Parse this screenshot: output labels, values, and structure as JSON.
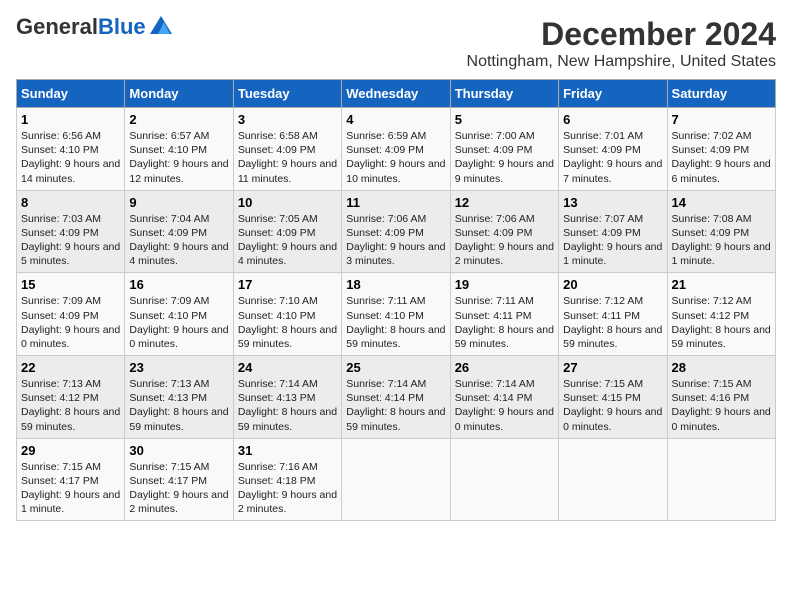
{
  "logo": {
    "general": "General",
    "blue": "Blue"
  },
  "title": "December 2024",
  "subtitle": "Nottingham, New Hampshire, United States",
  "days_of_week": [
    "Sunday",
    "Monday",
    "Tuesday",
    "Wednesday",
    "Thursday",
    "Friday",
    "Saturday"
  ],
  "weeks": [
    [
      {
        "day": "1",
        "sunrise": "Sunrise: 6:56 AM",
        "sunset": "Sunset: 4:10 PM",
        "daylight": "Daylight: 9 hours and 14 minutes."
      },
      {
        "day": "2",
        "sunrise": "Sunrise: 6:57 AM",
        "sunset": "Sunset: 4:10 PM",
        "daylight": "Daylight: 9 hours and 12 minutes."
      },
      {
        "day": "3",
        "sunrise": "Sunrise: 6:58 AM",
        "sunset": "Sunset: 4:09 PM",
        "daylight": "Daylight: 9 hours and 11 minutes."
      },
      {
        "day": "4",
        "sunrise": "Sunrise: 6:59 AM",
        "sunset": "Sunset: 4:09 PM",
        "daylight": "Daylight: 9 hours and 10 minutes."
      },
      {
        "day": "5",
        "sunrise": "Sunrise: 7:00 AM",
        "sunset": "Sunset: 4:09 PM",
        "daylight": "Daylight: 9 hours and 9 minutes."
      },
      {
        "day": "6",
        "sunrise": "Sunrise: 7:01 AM",
        "sunset": "Sunset: 4:09 PM",
        "daylight": "Daylight: 9 hours and 7 minutes."
      },
      {
        "day": "7",
        "sunrise": "Sunrise: 7:02 AM",
        "sunset": "Sunset: 4:09 PM",
        "daylight": "Daylight: 9 hours and 6 minutes."
      }
    ],
    [
      {
        "day": "8",
        "sunrise": "Sunrise: 7:03 AM",
        "sunset": "Sunset: 4:09 PM",
        "daylight": "Daylight: 9 hours and 5 minutes."
      },
      {
        "day": "9",
        "sunrise": "Sunrise: 7:04 AM",
        "sunset": "Sunset: 4:09 PM",
        "daylight": "Daylight: 9 hours and 4 minutes."
      },
      {
        "day": "10",
        "sunrise": "Sunrise: 7:05 AM",
        "sunset": "Sunset: 4:09 PM",
        "daylight": "Daylight: 9 hours and 4 minutes."
      },
      {
        "day": "11",
        "sunrise": "Sunrise: 7:06 AM",
        "sunset": "Sunset: 4:09 PM",
        "daylight": "Daylight: 9 hours and 3 minutes."
      },
      {
        "day": "12",
        "sunrise": "Sunrise: 7:06 AM",
        "sunset": "Sunset: 4:09 PM",
        "daylight": "Daylight: 9 hours and 2 minutes."
      },
      {
        "day": "13",
        "sunrise": "Sunrise: 7:07 AM",
        "sunset": "Sunset: 4:09 PM",
        "daylight": "Daylight: 9 hours and 1 minute."
      },
      {
        "day": "14",
        "sunrise": "Sunrise: 7:08 AM",
        "sunset": "Sunset: 4:09 PM",
        "daylight": "Daylight: 9 hours and 1 minute."
      }
    ],
    [
      {
        "day": "15",
        "sunrise": "Sunrise: 7:09 AM",
        "sunset": "Sunset: 4:09 PM",
        "daylight": "Daylight: 9 hours and 0 minutes."
      },
      {
        "day": "16",
        "sunrise": "Sunrise: 7:09 AM",
        "sunset": "Sunset: 4:10 PM",
        "daylight": "Daylight: 9 hours and 0 minutes."
      },
      {
        "day": "17",
        "sunrise": "Sunrise: 7:10 AM",
        "sunset": "Sunset: 4:10 PM",
        "daylight": "Daylight: 8 hours and 59 minutes."
      },
      {
        "day": "18",
        "sunrise": "Sunrise: 7:11 AM",
        "sunset": "Sunset: 4:10 PM",
        "daylight": "Daylight: 8 hours and 59 minutes."
      },
      {
        "day": "19",
        "sunrise": "Sunrise: 7:11 AM",
        "sunset": "Sunset: 4:11 PM",
        "daylight": "Daylight: 8 hours and 59 minutes."
      },
      {
        "day": "20",
        "sunrise": "Sunrise: 7:12 AM",
        "sunset": "Sunset: 4:11 PM",
        "daylight": "Daylight: 8 hours and 59 minutes."
      },
      {
        "day": "21",
        "sunrise": "Sunrise: 7:12 AM",
        "sunset": "Sunset: 4:12 PM",
        "daylight": "Daylight: 8 hours and 59 minutes."
      }
    ],
    [
      {
        "day": "22",
        "sunrise": "Sunrise: 7:13 AM",
        "sunset": "Sunset: 4:12 PM",
        "daylight": "Daylight: 8 hours and 59 minutes."
      },
      {
        "day": "23",
        "sunrise": "Sunrise: 7:13 AM",
        "sunset": "Sunset: 4:13 PM",
        "daylight": "Daylight: 8 hours and 59 minutes."
      },
      {
        "day": "24",
        "sunrise": "Sunrise: 7:14 AM",
        "sunset": "Sunset: 4:13 PM",
        "daylight": "Daylight: 8 hours and 59 minutes."
      },
      {
        "day": "25",
        "sunrise": "Sunrise: 7:14 AM",
        "sunset": "Sunset: 4:14 PM",
        "daylight": "Daylight: 8 hours and 59 minutes."
      },
      {
        "day": "26",
        "sunrise": "Sunrise: 7:14 AM",
        "sunset": "Sunset: 4:14 PM",
        "daylight": "Daylight: 9 hours and 0 minutes."
      },
      {
        "day": "27",
        "sunrise": "Sunrise: 7:15 AM",
        "sunset": "Sunset: 4:15 PM",
        "daylight": "Daylight: 9 hours and 0 minutes."
      },
      {
        "day": "28",
        "sunrise": "Sunrise: 7:15 AM",
        "sunset": "Sunset: 4:16 PM",
        "daylight": "Daylight: 9 hours and 0 minutes."
      }
    ],
    [
      {
        "day": "29",
        "sunrise": "Sunrise: 7:15 AM",
        "sunset": "Sunset: 4:17 PM",
        "daylight": "Daylight: 9 hours and 1 minute."
      },
      {
        "day": "30",
        "sunrise": "Sunrise: 7:15 AM",
        "sunset": "Sunset: 4:17 PM",
        "daylight": "Daylight: 9 hours and 2 minutes."
      },
      {
        "day": "31",
        "sunrise": "Sunrise: 7:16 AM",
        "sunset": "Sunset: 4:18 PM",
        "daylight": "Daylight: 9 hours and 2 minutes."
      },
      {
        "day": "",
        "sunrise": "",
        "sunset": "",
        "daylight": ""
      },
      {
        "day": "",
        "sunrise": "",
        "sunset": "",
        "daylight": ""
      },
      {
        "day": "",
        "sunrise": "",
        "sunset": "",
        "daylight": ""
      },
      {
        "day": "",
        "sunrise": "",
        "sunset": "",
        "daylight": ""
      }
    ]
  ]
}
